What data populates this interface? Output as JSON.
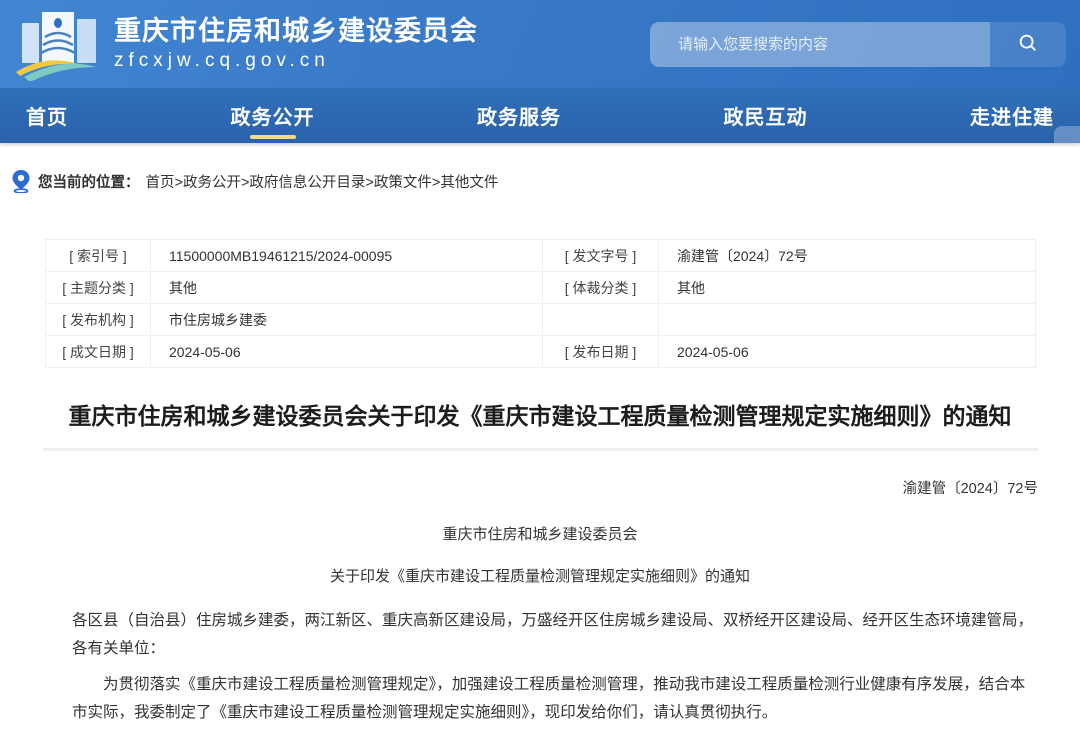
{
  "header": {
    "site_title": "重庆市住房和城乡建设委员会",
    "site_url": "zfcxjw.cq.gov.cn",
    "search_placeholder": "请输入您要搜索的内容"
  },
  "nav": {
    "items": [
      {
        "label": "首页"
      },
      {
        "label": "政务公开",
        "active": true
      },
      {
        "label": "政务服务"
      },
      {
        "label": "政民互动"
      },
      {
        "label": "走进住建"
      }
    ]
  },
  "breadcrumb": {
    "label": "您当前的位置：",
    "path": "首页>政务公开>政府信息公开目录>政策文件>其他文件"
  },
  "meta_table": {
    "rows": [
      {
        "label1": "[ 索引号 ]",
        "value1": "11500000MB19461215/2024-00095",
        "label2": "[ 发文字号 ]",
        "value2": "渝建管〔2024〕72号"
      },
      {
        "label1": "[ 主题分类 ]",
        "value1": "其他",
        "label2": "[ 体裁分类 ]",
        "value2": "其他"
      },
      {
        "label1": "[ 发布机构 ]",
        "value1": "市住房城乡建委",
        "label2": "",
        "value2": ""
      },
      {
        "label1": "[ 成文日期 ]",
        "value1": "2024-05-06",
        "label2": "[ 发布日期 ]",
        "value2": "2024-05-06"
      }
    ]
  },
  "document": {
    "title": "重庆市住房和城乡建设委员会关于印发《重庆市建设工程质量检测管理规定实施细则》的通知",
    "doc_number": "渝建管〔2024〕72号",
    "org_name": "重庆市住房和城乡建设委员会",
    "subtitle": "关于印发《重庆市建设工程质量检测管理规定实施细则》的通知",
    "paragraphs": [
      "各区县（自治县）住房城乡建委，两江新区、重庆高新区建设局，万盛经开区住房城乡建设局、双桥经开区建设局、经开区生态环境建管局，各有关单位：",
      "为贯彻落实《重庆市建设工程质量检测管理规定》，加强建设工程质量检测管理，推动我市建设工程质量检测行业健康有序发展，结合本市实际，我委制定了《重庆市建设工程质量检测管理规定实施细则》，现印发给你们，请认真贯彻执行。"
    ]
  },
  "colors": {
    "header_blue": "#3878c6",
    "nav_blue": "#2d66b0",
    "accent_yellow": "#f6d98a",
    "link_blue": "#2b6bd3"
  }
}
